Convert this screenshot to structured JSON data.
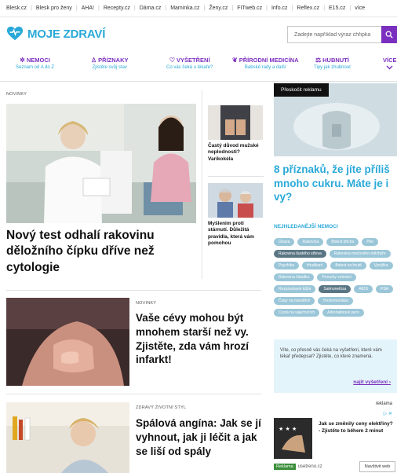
{
  "portal_links": [
    "Blesk.cz",
    "Blesk pro ženy",
    "AHA!",
    "Recepty.cz",
    "Dáma.cz",
    "Maminka.cz",
    "Ženy.cz",
    "FITweb.cz",
    "Info.cz",
    "Reflex.cz",
    "E15.cz",
    "více"
  ],
  "header": {
    "logo_text": "MOJE ZDRAVÍ",
    "search_placeholder": "Zadejte například výraz chřipka"
  },
  "nav": [
    {
      "label": "NEMOCI",
      "sub": "Seznam od A do Z",
      "icon": "virus-icon",
      "glyph": "✲"
    },
    {
      "label": "PŘÍZNAKY",
      "sub": "Zjistěte svůj stav",
      "icon": "body-icon",
      "glyph": "♙"
    },
    {
      "label": "VYŠETŘENÍ",
      "sub": "Co vás čeká u lékaře?",
      "icon": "stethoscope-icon",
      "glyph": "♡"
    },
    {
      "label": "PŘÍRODNÍ MEDICÍNA",
      "sub": "Babské rady a další",
      "icon": "leaf-icon",
      "glyph": "❦"
    },
    {
      "label": "HUBNUTÍ",
      "sub": "Tipy jak zhubnout",
      "icon": "scale-icon",
      "glyph": "⚖"
    },
    {
      "label": "VÍCE",
      "sub": "",
      "icon": "chevron-down-icon",
      "glyph": ""
    }
  ],
  "hero": {
    "kicker": "NOVINKY",
    "title": "Nový test odhalí rakovinu děložního čípku dříve než cytologie"
  },
  "side_articles": [
    {
      "title": "Častý důvod mužské neplodnosti? Varikokéla"
    },
    {
      "title": "Myšlenim proti stárnutí. Důležitá pravidla, která vám pomohou"
    }
  ],
  "ad_top": {
    "skip_label": "Přeskočit reklamu"
  },
  "promo": {
    "title": "8 příznaků, že jíte příliš mnoho cukru. Máte je i vy?"
  },
  "diseases": {
    "heading": "NEJHLEDANĚJŠÍ NEMOCI",
    "tags": [
      {
        "label": "Únava",
        "dark": false
      },
      {
        "label": "Rakovina",
        "dark": false
      },
      {
        "label": "Bolest břicha",
        "dark": false
      },
      {
        "label": "Plet",
        "dark": false
      },
      {
        "label": "Rakovina tlustého střeva",
        "dark": true
      },
      {
        "label": "Rakovina močového měchýře",
        "dark": false
      },
      {
        "label": "Psychika",
        "dark": false
      },
      {
        "label": "Hrudkaní",
        "dark": false
      },
      {
        "label": "Bolest na hrudi",
        "dark": false
      },
      {
        "label": "Vyrážka",
        "dark": false
      },
      {
        "label": "Rakovina žaludku",
        "dark": false
      },
      {
        "label": "Poruchy vnímání",
        "dark": false
      },
      {
        "label": "Rozpraskané kůže",
        "dark": false
      },
      {
        "label": "Salmonelóza",
        "dark": true
      },
      {
        "label": "AIDS",
        "dark": false
      },
      {
        "label": "PSA",
        "dark": false
      },
      {
        "label": "Čepy na mandlích",
        "dark": false
      },
      {
        "label": "Trichomoniáza",
        "dark": false
      },
      {
        "label": "Cysta na vaječnících",
        "dark": false
      },
      {
        "label": "Adrenalinové pero",
        "dark": false
      }
    ]
  },
  "info_box": {
    "text": "Víte, co přesně vás čeká na vyšetření, které vám lékař předepsal? Zjistěte, co které znamená.",
    "link": "najít vyšetření"
  },
  "ad_bottom": {
    "reklama": "reklama",
    "text": "Jak se změnily ceny elektřiny? - Zjistěte to během 2 minut",
    "badge": "Reklama",
    "domain": "usetreno.cz",
    "button": "Navštivit web"
  },
  "articles": [
    {
      "kicker": "NOVINKY",
      "title": "Vaše cévy mohou být mnohem starší než vy. Zjistěte, zda vám hrozí infarkt!"
    },
    {
      "kicker": "ZDRAVÝ ŽIVOTNÍ STYL",
      "title": "Spálová angína: Jak se jí vyhnout, jak ji léčit a jak se liší od spály"
    }
  ],
  "colors": {
    "brand_blue": "#2aa9d8",
    "brand_purple": "#7b2fbf"
  }
}
